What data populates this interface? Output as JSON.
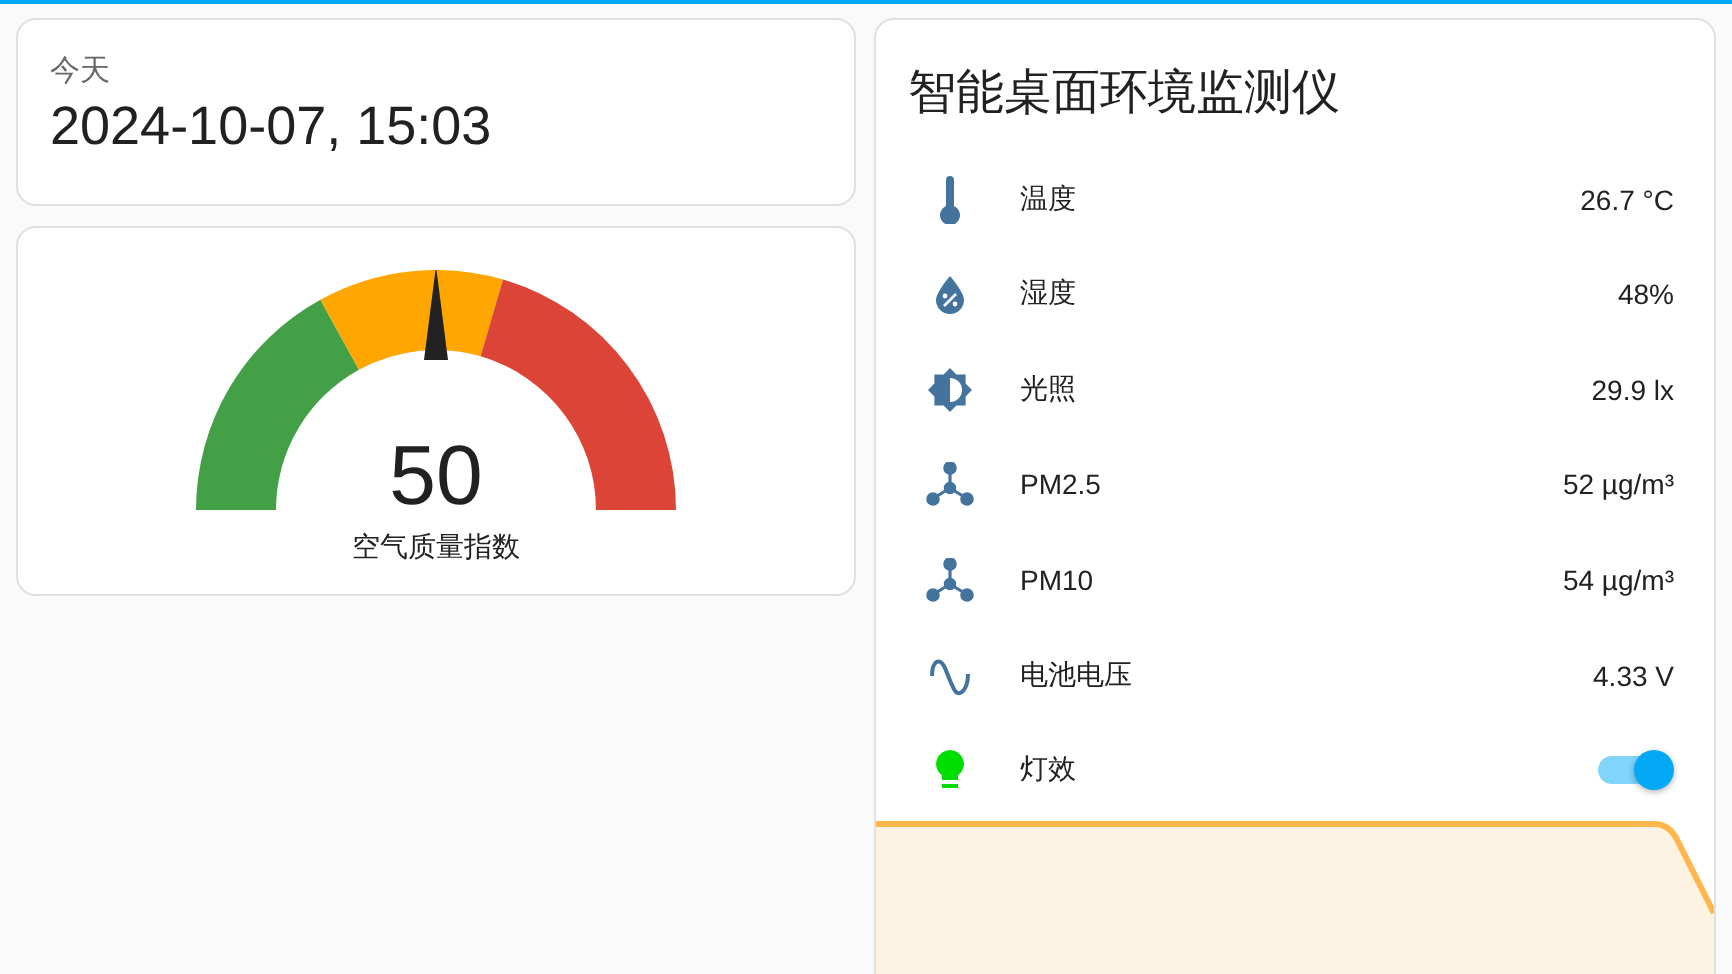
{
  "date_card": {
    "label": "今天",
    "value": "2024-10-07, 15:03"
  },
  "gauge_card": {
    "value": "50",
    "name": "空气质量指数",
    "level": 0.5
  },
  "sensor_card": {
    "title": "智能桌面环境监测仪",
    "rows": [
      {
        "kind": "sensor",
        "label": "温度",
        "value": "26.7 °C"
      },
      {
        "kind": "sensor",
        "label": "湿度",
        "value": "48%"
      },
      {
        "kind": "sensor",
        "label": "光照",
        "value": "29.9 lx"
      },
      {
        "kind": "sensor",
        "label": "PM2.5",
        "value": "52 µg/m³"
      },
      {
        "kind": "sensor",
        "label": "PM10",
        "value": "54 µg/m³"
      },
      {
        "kind": "sensor",
        "label": "电池电压",
        "value": "4.33 V"
      },
      {
        "kind": "toggle",
        "label": "灯效",
        "on": true
      }
    ]
  }
}
